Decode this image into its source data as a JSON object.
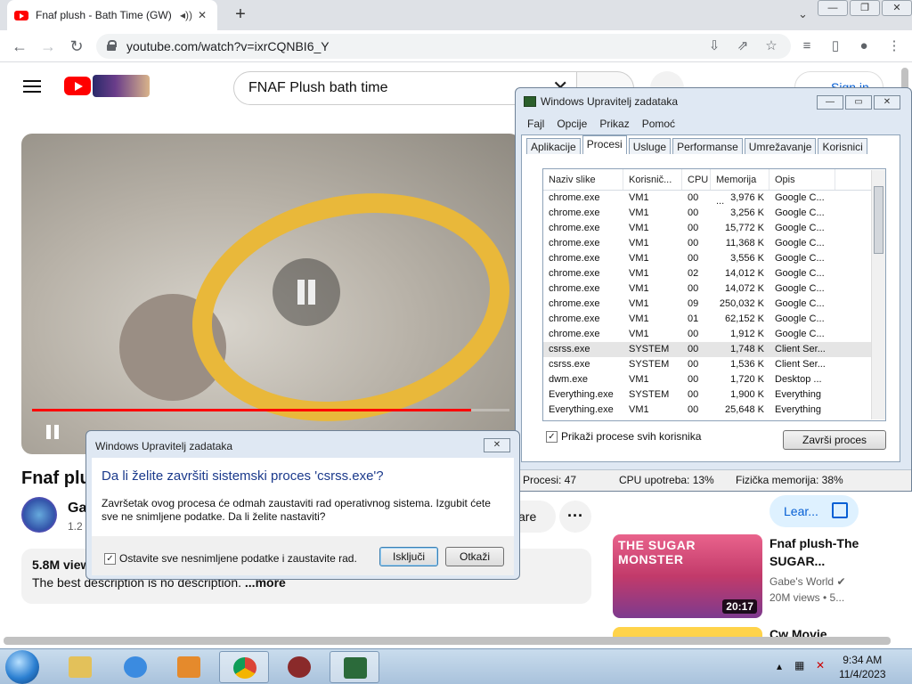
{
  "browser": {
    "tab_title": "Fnaf plush - Bath Time (GW)",
    "url": "youtube.com/watch?v=ixrCQNBI6_Y"
  },
  "youtube": {
    "search_value": "FNAF Plush bath time",
    "sign_in": "Sign in",
    "video_title": "Fnaf plu",
    "channel_name": "Ga",
    "subscribers": "1.2",
    "share_label": "are",
    "views": "5.8M view",
    "description": "The best description is no description. ",
    "description_more": "...more",
    "learn_more": "Lear...",
    "video_progress": 0.92,
    "recommendation": {
      "thumb_text": "THE SUGAR MONSTER",
      "duration": "20:17",
      "title": "Fnaf plush-The SUGAR...",
      "channel": "Gabe's World",
      "meta": "20M views • 5..."
    },
    "recommendation2_title": "Cw Movie"
  },
  "task_manager": {
    "title": "Windows Upravitelj zadataka",
    "menu": [
      "Fajl",
      "Opcije",
      "Prikaz",
      "Pomoć"
    ],
    "tabs": [
      "Aplikacije",
      "Procesi",
      "Usluge",
      "Performanse",
      "Umrežavanje",
      "Korisnici"
    ],
    "active_tab": "Procesi",
    "columns": [
      "Naziv slike",
      "Korisnič...",
      "CPU",
      "Memorija ...",
      "Opis"
    ],
    "rows": [
      [
        "chrome.exe",
        "VM1",
        "00",
        "3,976 K",
        "Google C..."
      ],
      [
        "chrome.exe",
        "VM1",
        "00",
        "3,256 K",
        "Google C..."
      ],
      [
        "chrome.exe",
        "VM1",
        "00",
        "15,772 K",
        "Google C..."
      ],
      [
        "chrome.exe",
        "VM1",
        "00",
        "11,368 K",
        "Google C..."
      ],
      [
        "chrome.exe",
        "VM1",
        "00",
        "3,556 K",
        "Google C..."
      ],
      [
        "chrome.exe",
        "VM1",
        "02",
        "14,012 K",
        "Google C..."
      ],
      [
        "chrome.exe",
        "VM1",
        "00",
        "14,072 K",
        "Google C..."
      ],
      [
        "chrome.exe",
        "VM1",
        "09",
        "250,032 K",
        "Google C..."
      ],
      [
        "chrome.exe",
        "VM1",
        "01",
        "62,152 K",
        "Google C..."
      ],
      [
        "chrome.exe",
        "VM1",
        "00",
        "1,912 K",
        "Google C..."
      ],
      [
        "csrss.exe",
        "SYSTEM",
        "00",
        "1,748 K",
        "Client Ser..."
      ],
      [
        "csrss.exe",
        "SYSTEM",
        "00",
        "1,536 K",
        "Client Ser..."
      ],
      [
        "dwm.exe",
        "VM1",
        "00",
        "1,720 K",
        "Desktop ..."
      ],
      [
        "Everything.exe",
        "SYSTEM",
        "00",
        "1,900 K",
        "Everything"
      ],
      [
        "Everything.exe",
        "VM1",
        "00",
        "25,648 K",
        "Everything"
      ]
    ],
    "selected_row": 10,
    "show_all": "Prikaži procese svih korisnika",
    "end_process": "Završi proces",
    "status": {
      "processes": "Procesi: 47",
      "cpu": "CPU upotreba: 13%",
      "memory": "Fizička memorija: 38%"
    }
  },
  "dialog": {
    "title": "Windows Upravitelj zadataka",
    "question": "Da li želite završiti sistemski proces 'csrss.exe'?",
    "text": "Završetak ovog procesa će odmah zaustaviti rad operativnog sistema. Izgubit ćete sve ne snimljene podatke. Da li želite nastaviti?",
    "checkbox": "Ostavite sve nesnimljene podatke i zaustavite rad.",
    "confirm": "Isključi",
    "cancel": "Otkaži"
  },
  "taskbar": {
    "time": "9:34 AM",
    "date": "11/4/2023"
  }
}
